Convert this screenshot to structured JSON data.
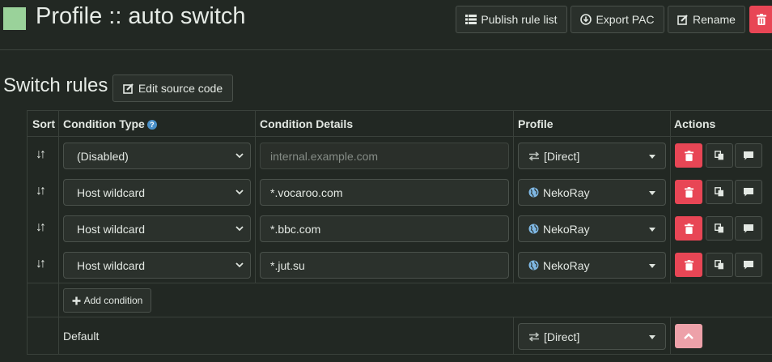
{
  "header": {
    "color": "#9ad29a",
    "title": "Profile :: auto switch",
    "buttons": [
      {
        "label": "Publish rule list",
        "icon": "list-icon"
      },
      {
        "label": "Export PAC",
        "icon": "download-icon"
      },
      {
        "label": "Rename",
        "icon": "edit-icon"
      },
      {
        "label": "",
        "icon": "trash-icon"
      }
    ]
  },
  "section": {
    "title": "Switch rules",
    "edit_source_label": "Edit source code"
  },
  "table": {
    "columns": [
      "Sort",
      "Condition Type",
      "Condition Details",
      "Profile",
      "Actions"
    ],
    "rows": [
      {
        "condition_type": "(Disabled)",
        "details": "",
        "details_placeholder": "internal.example.com",
        "profile": "[Direct]",
        "profile_icon": "transfer-icon"
      },
      {
        "condition_type": "Host wildcard",
        "details": "*.vocaroo.com",
        "profile": "NekoRay",
        "profile_icon": "globe-icon"
      },
      {
        "condition_type": "Host wildcard",
        "details": "*.bbc.com",
        "profile": "NekoRay",
        "profile_icon": "globe-icon"
      },
      {
        "condition_type": "Host wildcard",
        "details": "*.jut.su",
        "profile": "NekoRay",
        "profile_icon": "globe-icon"
      }
    ],
    "add_condition_label": "Add condition",
    "default_label": "Default",
    "default_profile": "[Direct]"
  },
  "colors": {
    "background": "#222823",
    "danger": "#e84655",
    "danger_light": "#eda1a9",
    "accent": "#4a90c8"
  }
}
